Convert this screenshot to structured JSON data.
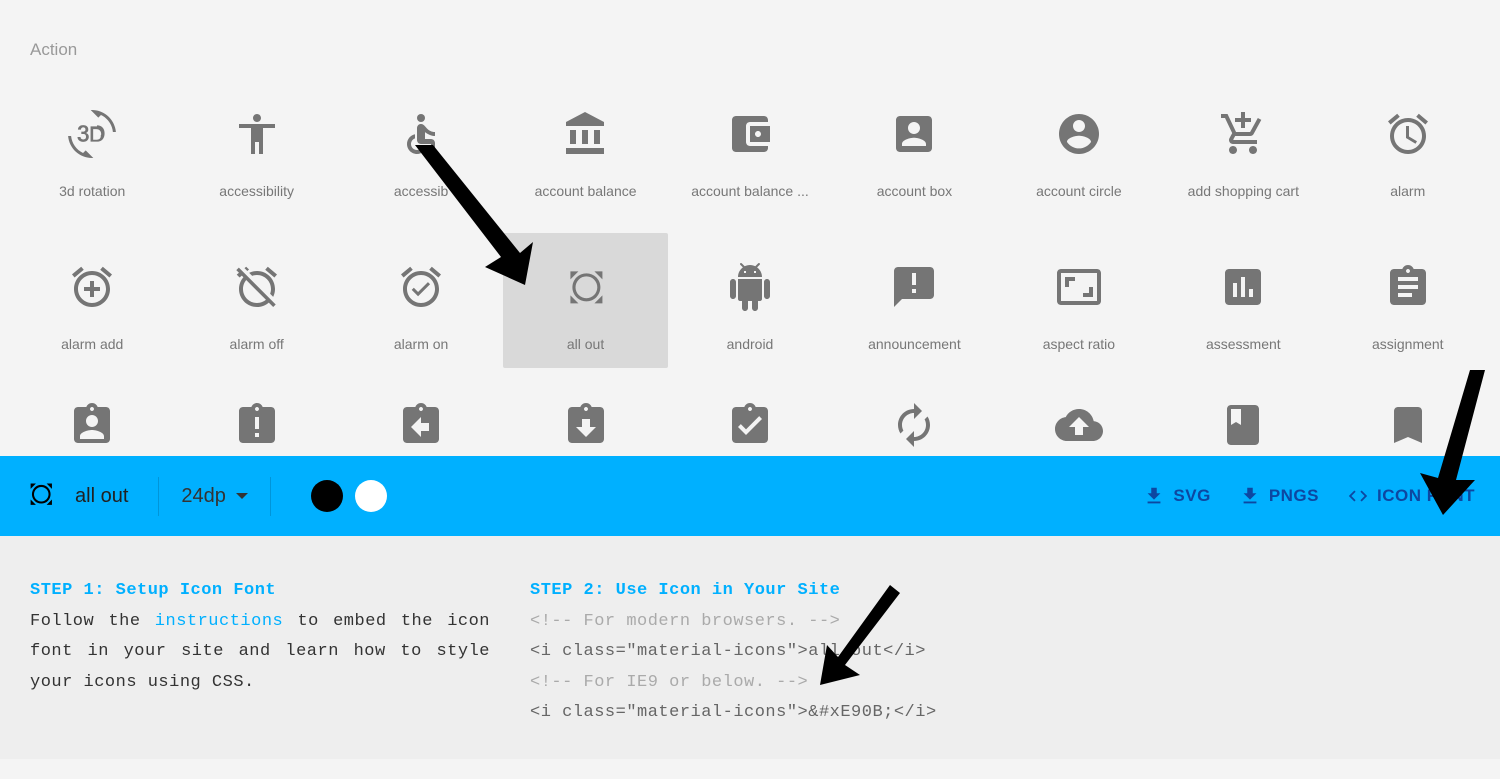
{
  "category": "Action",
  "icons_row1": [
    {
      "id": "3d-rotation",
      "label": "3d rotation"
    },
    {
      "id": "accessibility",
      "label": "accessibility"
    },
    {
      "id": "accessible",
      "label": "accessib"
    },
    {
      "id": "account-balance",
      "label": "account balance"
    },
    {
      "id": "account-balance-wallet",
      "label": "account balance ..."
    },
    {
      "id": "account-box",
      "label": "account box"
    },
    {
      "id": "account-circle",
      "label": "account circle"
    },
    {
      "id": "add-shopping-cart",
      "label": "add shopping cart"
    },
    {
      "id": "alarm",
      "label": "alarm"
    }
  ],
  "icons_row2": [
    {
      "id": "alarm-add",
      "label": "alarm add"
    },
    {
      "id": "alarm-off",
      "label": "alarm off"
    },
    {
      "id": "alarm-on",
      "label": "alarm on"
    },
    {
      "id": "all-out",
      "label": "all out",
      "selected": true
    },
    {
      "id": "android",
      "label": "android"
    },
    {
      "id": "announcement",
      "label": "announcement"
    },
    {
      "id": "aspect-ratio",
      "label": "aspect ratio"
    },
    {
      "id": "assessment",
      "label": "assessment"
    },
    {
      "id": "assignment",
      "label": "assignment"
    }
  ],
  "icons_row3": [
    {
      "id": "assignment-ind",
      "label": ""
    },
    {
      "id": "assignment-late",
      "label": ""
    },
    {
      "id": "assignment-return",
      "label": ""
    },
    {
      "id": "assignment-returned",
      "label": ""
    },
    {
      "id": "assignment-turned-in",
      "label": ""
    },
    {
      "id": "autorenew",
      "label": ""
    },
    {
      "id": "backup",
      "label": ""
    },
    {
      "id": "book",
      "label": ""
    },
    {
      "id": "bookmark",
      "label": ""
    }
  ],
  "detail": {
    "name": "all out",
    "size": "24dp",
    "download_svg": "SVG",
    "download_pngs": "PNGS",
    "icon_font": "ICON FONT",
    "selected_color": "black"
  },
  "step1": {
    "title": "STEP 1: Setup Icon Font",
    "text_before": "Follow the ",
    "link": "instructions",
    "text_after": " to embed the icon font in your site and learn how to style your icons using CSS."
  },
  "step2": {
    "title": "STEP 2: Use Icon in Your Site",
    "comment1": "<!-- For modern browsers. -->",
    "code1": "<i class=\"material-icons\">all_out</i>",
    "comment2": "<!-- For IE9 or below. -->",
    "code2": "<i class=\"material-icons\">&#xE90B;</i>"
  }
}
